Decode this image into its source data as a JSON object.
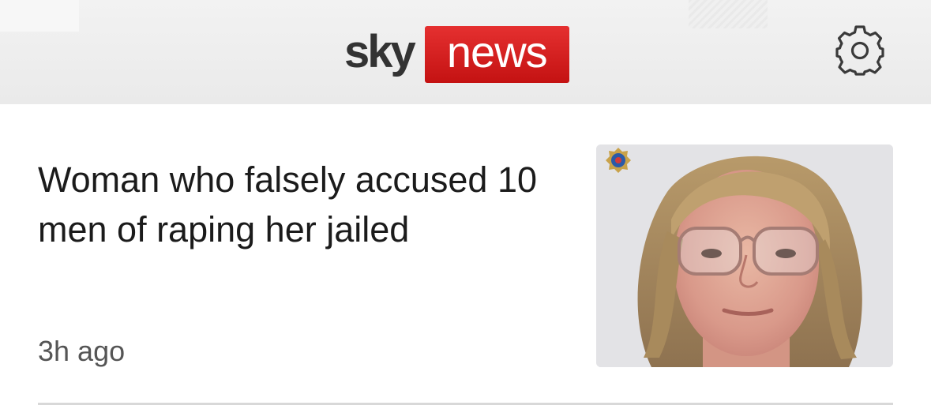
{
  "header": {
    "logo_sky": "sky",
    "logo_news": "news",
    "settings_icon": "gear-icon",
    "brand_red": "#d41e1e"
  },
  "article": {
    "headline": "Woman who falsely accused 10 men of raping her jailed",
    "time": "3h ago",
    "thumbnail_icon": "police-badge-icon"
  }
}
